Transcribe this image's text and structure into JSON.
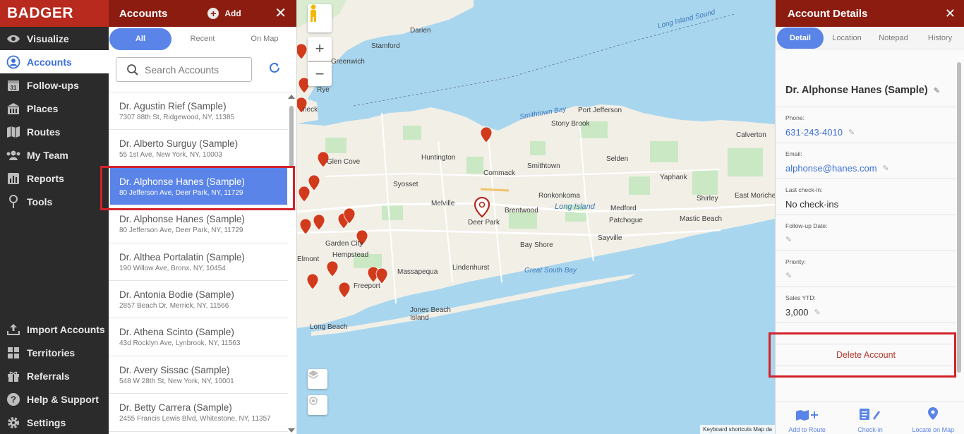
{
  "app": {
    "logo": "BADGER"
  },
  "nav": {
    "items": [
      {
        "label": "Visualize",
        "icon": "eye-icon"
      },
      {
        "label": "Accounts",
        "icon": "person-circle-icon",
        "active": true
      },
      {
        "label": "Follow-ups",
        "icon": "calendar-icon",
        "badge": "31"
      },
      {
        "label": "Places",
        "icon": "building-icon"
      },
      {
        "label": "Routes",
        "icon": "map-icon"
      },
      {
        "label": "My Team",
        "icon": "team-icon"
      },
      {
        "label": "Reports",
        "icon": "bar-chart-icon"
      },
      {
        "label": "Tools",
        "icon": "tools-icon"
      }
    ],
    "bottom_items": [
      {
        "label": "Import Accounts",
        "icon": "upload-icon"
      },
      {
        "label": "Territories",
        "icon": "grid-icon"
      },
      {
        "label": "Referrals",
        "icon": "gift-icon"
      },
      {
        "label": "Help & Support",
        "icon": "help-icon"
      },
      {
        "label": "Settings",
        "icon": "gear-icon"
      }
    ]
  },
  "accounts": {
    "title": "Accounts",
    "add_label": "Add",
    "close": "✕",
    "filters": [
      "All",
      "Recent",
      "On Map"
    ],
    "search_placeholder": "Search Accounts",
    "rows": [
      {
        "name": "Dr. Agustin Rief (Sample)",
        "addr": "7307 88th St, Ridgewood, NY, 11385"
      },
      {
        "name": "Dr. Alberto Surguy (Sample)",
        "addr": "55 1st Ave, New York, NY, 10003"
      },
      {
        "name": "Dr. Alphonse Hanes (Sample)",
        "addr": "80 Jefferson Ave, Deer Park, NY, 11729",
        "selected": true
      },
      {
        "name": "Dr. Alphonse Hanes (Sample)",
        "addr": "80 Jefferson Ave, Deer Park, NY, 11729"
      },
      {
        "name": "Dr. Althea Portalatin (Sample)",
        "addr": "190 Willow Ave, Bronx, NY, 10454"
      },
      {
        "name": "Dr. Antonia Bodie (Sample)",
        "addr": "2857 Beach Dr, Merrick, NY, 11566"
      },
      {
        "name": "Dr. Athena Scinto (Sample)",
        "addr": "43d Rocklyn Ave, Lynbrook, NY, 11563"
      },
      {
        "name": "Dr. Avery Sissac (Sample)",
        "addr": "548 W 28th St, New York, NY, 10001"
      },
      {
        "name": "Dr. Betty Carrera (Sample)",
        "addr": "2455 Francis Lewis Blvd, Whitestone, NY, 11357"
      }
    ]
  },
  "map": {
    "labels": [
      {
        "text": "Darien"
      },
      {
        "text": "Stamford"
      },
      {
        "text": "Greenwich"
      },
      {
        "text": "Rye"
      },
      {
        "text": "neck"
      },
      {
        "text": "Long Island Sound"
      },
      {
        "text": "Smithtown Bay"
      },
      {
        "text": "Port Jefferson"
      },
      {
        "text": "Stony Brook"
      },
      {
        "text": "Calverton"
      },
      {
        "text": "Huntington"
      },
      {
        "text": "Glen Cove"
      },
      {
        "text": "Commack"
      },
      {
        "text": "Smithtown"
      },
      {
        "text": "Selden"
      },
      {
        "text": "Yaphank"
      },
      {
        "text": "Syosset"
      },
      {
        "text": "Ronkonkoma"
      },
      {
        "text": "Long Island"
      },
      {
        "text": "Melville"
      },
      {
        "text": "Brentwood"
      },
      {
        "text": "Medford"
      },
      {
        "text": "Shirley"
      },
      {
        "text": "East Moriches"
      },
      {
        "text": "Deer Park"
      },
      {
        "text": "Patchogue"
      },
      {
        "text": "Mastic Beach"
      },
      {
        "text": "Garden City"
      },
      {
        "text": "Hempstead"
      },
      {
        "text": "Bay Shore"
      },
      {
        "text": "Sayville"
      },
      {
        "text": "Lindenhurst"
      },
      {
        "text": "Massapequa"
      },
      {
        "text": "Great South Bay"
      },
      {
        "text": "Elmont"
      },
      {
        "text": "Freeport"
      },
      {
        "text": "Jones Beach Island"
      },
      {
        "text": "Long Beach"
      }
    ],
    "attribution": "Keyboard shortcuts   Map da"
  },
  "details": {
    "title": "Account Details",
    "close": "✕",
    "tabs": [
      "Detail",
      "Location",
      "Notepad",
      "History"
    ],
    "name": "Dr. Alphonse Hanes (Sample)",
    "fields": [
      {
        "label": "Phone:",
        "value": "631-243-4010",
        "link": true
      },
      {
        "label": "Email:",
        "value": "alphonse@hanes.com",
        "link": true
      },
      {
        "label": "Last check-in:",
        "value": "No check-ins",
        "link": false,
        "no_pencil": true
      },
      {
        "label": "Follow-up Date:",
        "value": "",
        "link": false
      },
      {
        "label": "Priority:",
        "value": "",
        "link": false
      },
      {
        "label": "Sales YTD:",
        "value": "3,000",
        "link": false
      }
    ],
    "delete_label": "Delete Account",
    "footer": [
      {
        "label": "Add to Route",
        "icon": "map-plus-icon"
      },
      {
        "label": "Check-in",
        "icon": "checkin-icon"
      },
      {
        "label": "Locate on Map",
        "icon": "location-pin-icon"
      }
    ]
  },
  "colors": {
    "brand_red": "#8c1c10",
    "logo_red": "#b8291e",
    "accent_blue": "#5a84e8",
    "highlight": "#d3232a",
    "pin_red": "#d23a1c"
  }
}
